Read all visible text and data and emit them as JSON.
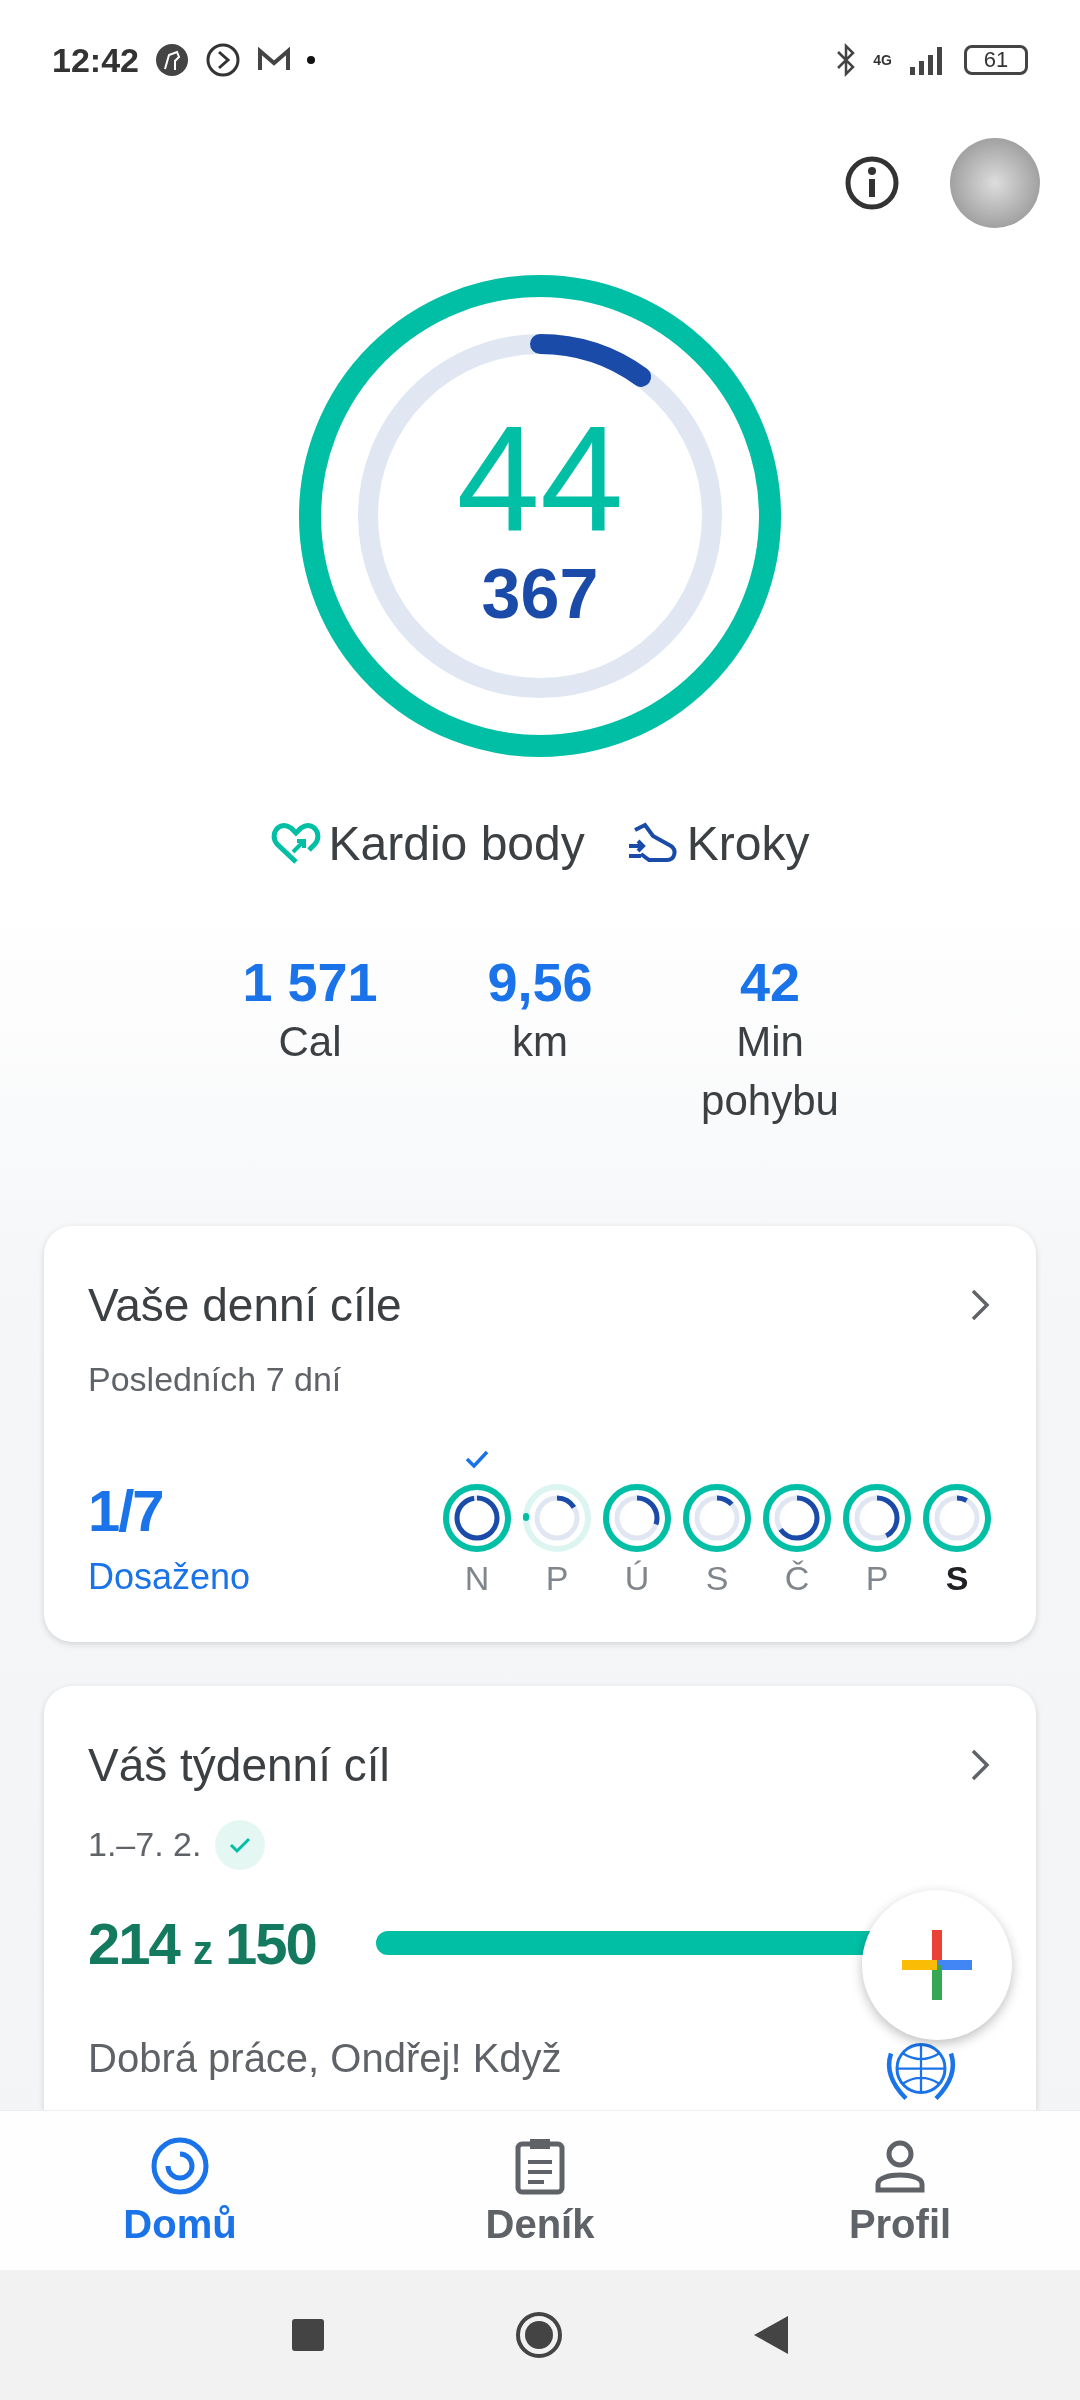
{
  "status_bar": {
    "time": "12:42",
    "network": "4G",
    "battery": "61"
  },
  "rings": {
    "cardio": {
      "value": "44",
      "level": 1
    },
    "steps": {
      "value": "367",
      "level": 0.1
    }
  },
  "legend": [
    {
      "kind": "cardio",
      "label": "Kardio body"
    },
    {
      "kind": "steps",
      "label": "Kroky"
    }
  ],
  "stats": [
    {
      "value": "1 571",
      "label": "Cal"
    },
    {
      "value": "9,56",
      "label": "km"
    },
    {
      "value": "42",
      "label": "Min pohybu"
    }
  ],
  "daily_goals": {
    "title": "Vaše denní cíle",
    "subtitle": "Posledních 7 dní",
    "count": "1/7",
    "count_label": "Dosaženo",
    "days": [
      {
        "label": "N",
        "achieved": true,
        "today": false,
        "cardio": {
          "level": 1
        },
        "steps": {
          "level": 0.97
        }
      },
      {
        "label": "P",
        "achieved": false,
        "today": false,
        "cardio": {
          "level": 0.01
        },
        "steps": {
          "level": 0.16
        }
      },
      {
        "label": "Ú",
        "achieved": false,
        "today": false,
        "cardio": {
          "level": 1
        },
        "steps": {
          "level": 0.3
        }
      },
      {
        "label": "S",
        "achieved": false,
        "today": false,
        "cardio": {
          "level": 1
        },
        "steps": {
          "level": 0.13
        }
      },
      {
        "label": "Č",
        "achieved": false,
        "today": false,
        "cardio": {
          "level": 1
        },
        "steps": {
          "level": 0.65
        }
      },
      {
        "label": "P",
        "achieved": false,
        "today": false,
        "cardio": {
          "level": 1
        },
        "steps": {
          "level": 0.42
        }
      },
      {
        "label": "S",
        "achieved": false,
        "today": true,
        "cardio": {
          "level": 1
        },
        "steps": {
          "level": 0.08
        }
      }
    ]
  },
  "weekly_goal": {
    "title": "Váš týdenní cíl",
    "dates": "1.–7. 2.",
    "completed": true,
    "score": "214",
    "separator": "z",
    "target": "150",
    "level": 1,
    "message": "Dobrá práce, Ondřej! Když"
  },
  "bottom_nav": [
    {
      "kind": "home",
      "label": "Domů",
      "selected": true
    },
    {
      "kind": "journal",
      "label": "Deník",
      "selected": false
    },
    {
      "kind": "profile",
      "label": "Profil",
      "selected": false
    }
  ]
}
